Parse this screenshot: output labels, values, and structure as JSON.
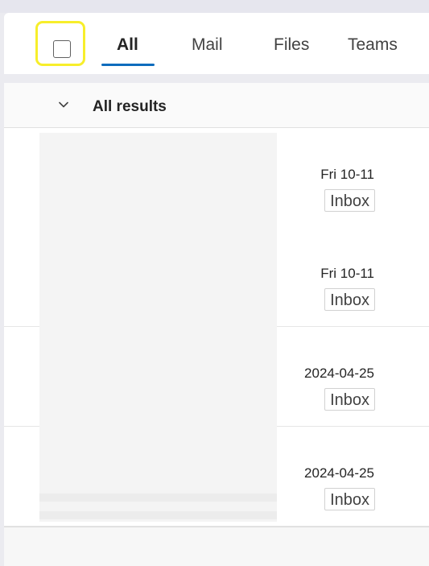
{
  "header": {
    "select_all_checked": false,
    "tabs": [
      {
        "label": "All",
        "active": true
      },
      {
        "label": "Mail",
        "active": false
      },
      {
        "label": "Files",
        "active": false
      },
      {
        "label": "Teams",
        "active": false
      }
    ]
  },
  "results": {
    "section_title": "All results",
    "items": [
      {
        "date": "Fri 10-11",
        "folder": "Inbox"
      },
      {
        "date": "Fri 10-11",
        "folder": "Inbox"
      },
      {
        "date": "2024-04-25",
        "folder": "Inbox"
      },
      {
        "date": "2024-04-25",
        "folder": "Inbox"
      }
    ]
  },
  "colors": {
    "accent": "#0f6cbd",
    "highlight": "#f7ee2b"
  }
}
